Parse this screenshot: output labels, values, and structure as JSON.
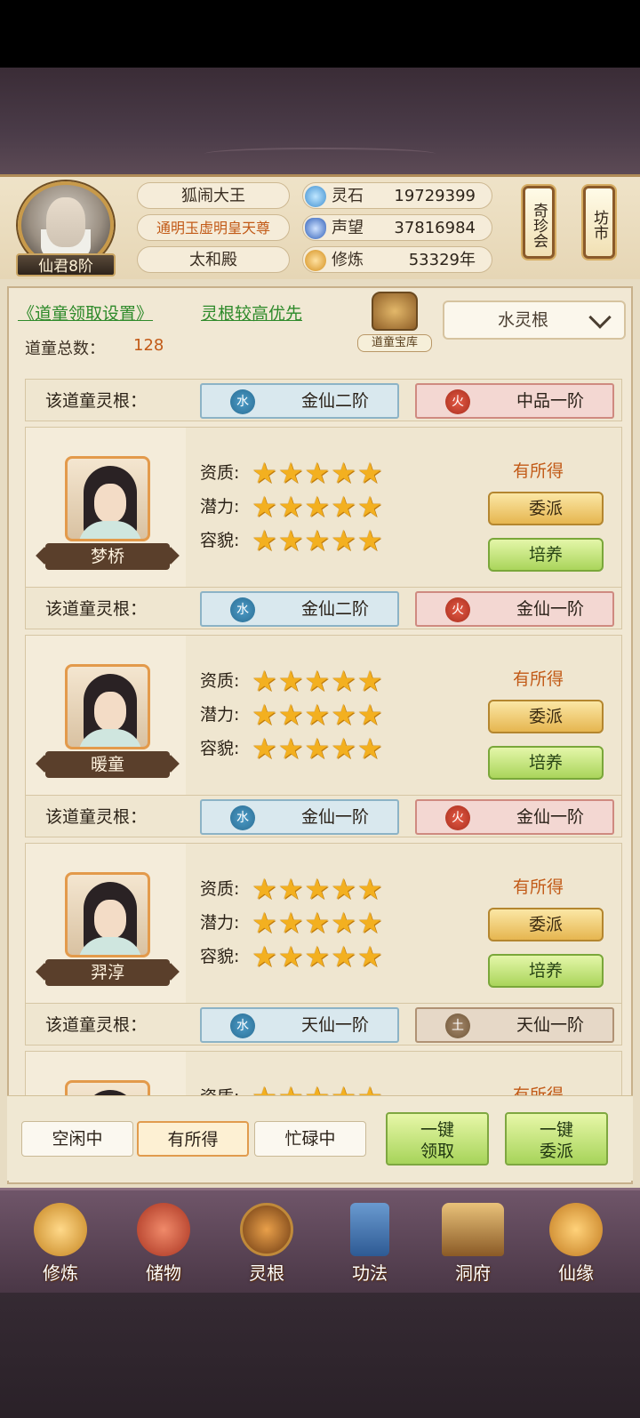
{
  "player": {
    "name": "狐闹大王",
    "title": "通明玉虚明皇天尊",
    "hall": "太和殿",
    "rank": "仙君8阶"
  },
  "resources": [
    {
      "label": "灵石",
      "value": "19729399",
      "icon": "spirit-stone-icon",
      "color": "#5aa7d8"
    },
    {
      "label": "声望",
      "value": "37816984",
      "icon": "prestige-crystal-icon",
      "color": "#3f78c8"
    },
    {
      "label": "修炼",
      "value": "53329年",
      "icon": "meditation-icon",
      "color": "#e0a23a"
    }
  ],
  "side_buttons": {
    "treasure_fair": "奇珍会",
    "market": "坊市"
  },
  "panel": {
    "settings_link": "《道童领取设置》",
    "priority_link": "灵根较高优先",
    "total_label": "道童总数：",
    "total_value": "128",
    "vault_label": "道童宝库",
    "dropdown_value": "水灵根"
  },
  "root_label": "该道童灵根：",
  "attr_labels": {
    "aptitude": "资质:",
    "potential": "潜力:",
    "looks": "容貌:"
  },
  "stars": "★★★★★",
  "btn_dispatch": "委派",
  "btn_train": "培养",
  "partial_top_roots": [
    {
      "element": "水",
      "type": "water",
      "text": "金仙二阶"
    },
    {
      "element": "火",
      "type": "fire",
      "text": "中品一阶"
    }
  ],
  "disciples": [
    {
      "name": "梦桥",
      "status": "有所得",
      "aptitude": 5,
      "potential": 5,
      "looks": 5,
      "roots": [
        {
          "element": "水",
          "type": "water",
          "text": "金仙二阶"
        },
        {
          "element": "火",
          "type": "fire",
          "text": "金仙一阶"
        }
      ]
    },
    {
      "name": "暖童",
      "status": "有所得",
      "aptitude": 5,
      "potential": 5,
      "looks": 5,
      "roots": [
        {
          "element": "水",
          "type": "water",
          "text": "金仙一阶"
        },
        {
          "element": "火",
          "type": "fire",
          "text": "金仙一阶"
        }
      ]
    },
    {
      "name": "羿淳",
      "status": "有所得",
      "aptitude": 5,
      "potential": 5,
      "looks": 5,
      "roots": [
        {
          "element": "水",
          "type": "water",
          "text": "天仙一阶"
        },
        {
          "element": "土",
          "type": "earth",
          "text": "天仙一阶"
        }
      ]
    }
  ],
  "partial_bottom": {
    "label": "资质:",
    "status": "有所得"
  },
  "filters": [
    {
      "label": "空闲中",
      "active": false
    },
    {
      "label": "有所得",
      "active": true
    },
    {
      "label": "忙碌中",
      "active": false
    }
  ],
  "bulk": {
    "collect_line1": "一键",
    "collect_line2": "领取",
    "dispatch_line1": "一键",
    "dispatch_line2": "委派"
  },
  "nav": [
    {
      "label": "修炼",
      "icon": "cultivate-icon",
      "color": "#d49a3a"
    },
    {
      "label": "储物",
      "icon": "storage-bag-icon",
      "color": "#c4503a"
    },
    {
      "label": "灵根",
      "icon": "spirit-root-icon",
      "color": "#9a5a2a"
    },
    {
      "label": "功法",
      "icon": "scripture-book-icon",
      "color": "#3a6fa8"
    },
    {
      "label": "洞府",
      "icon": "cave-palace-icon",
      "color": "#b58a4a"
    },
    {
      "label": "仙缘",
      "icon": "gourd-icon",
      "color": "#d8903a"
    }
  ]
}
